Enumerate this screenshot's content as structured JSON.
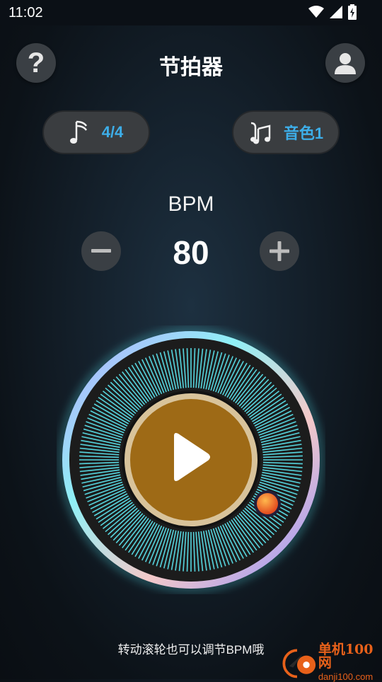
{
  "status_bar": {
    "time": "11:02"
  },
  "header": {
    "title": "节拍器"
  },
  "controls": {
    "time_signature": "4/4",
    "tone": "音色1"
  },
  "tempo": {
    "label": "BPM",
    "value": "80"
  },
  "dial": {
    "state": "paused"
  },
  "hint": "转动滚轮也可以调节BPM哦",
  "watermark": {
    "main": "单机100网",
    "sub": "danji100.com"
  },
  "colors": {
    "accent": "#3daee9",
    "play_button": "#9e6a16",
    "dial_lines": "#56d4dd",
    "knob": "#e8521c"
  }
}
